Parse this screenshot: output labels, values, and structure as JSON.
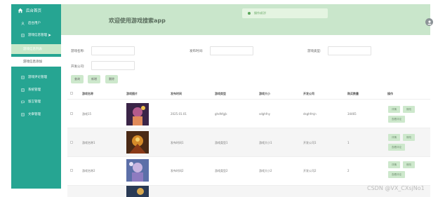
{
  "sidebar": {
    "home_label": "后台首页",
    "items": [
      {
        "label": "后台用户",
        "icon": "user-icon"
      },
      {
        "label": "游戏信息管理",
        "icon": "document-icon"
      },
      {
        "label": "游戏评论管理",
        "icon": "document-icon"
      },
      {
        "label": "系统管理",
        "icon": "document-icon"
      },
      {
        "label": "留言管理",
        "icon": "chat-icon"
      },
      {
        "label": "文章管理",
        "icon": "document-icon"
      }
    ],
    "subitems": [
      {
        "label": "游戏信息列表",
        "active": true
      },
      {
        "label": "游戏信息添加",
        "active": false
      }
    ]
  },
  "header": {
    "title": "欢迎使用游戏搜索app",
    "toast": "操作成功!",
    "user": "admin"
  },
  "search": {
    "fields": [
      {
        "label": "游戏名称:",
        "value": ""
      },
      {
        "label": "发布时间:",
        "value": ""
      },
      {
        "label": "游戏类型:",
        "value": ""
      },
      {
        "label": "开发公司:",
        "value": ""
      }
    ],
    "buttons": [
      "查询",
      "新增",
      "删除"
    ]
  },
  "table": {
    "headers": [
      "游戏名称",
      "游戏图片",
      "发布时间",
      "游戏类型",
      "游戏大小",
      "开发公司",
      "购买数量",
      "操作"
    ],
    "rows": [
      {
        "name": "游戏15",
        "date": "2025.01.01",
        "type": "ghdhfgjk",
        "size": "sdghfny",
        "company": "dsghfmjn",
        "count": "34465"
      },
      {
        "name": "游戏名称1",
        "date": "发布时间1",
        "type": "游戏类型1",
        "size": "游戏大小1",
        "company": "开发公司1",
        "count": "1"
      },
      {
        "name": "游戏名称2",
        "date": "发布时间2",
        "type": "游戏类型2",
        "size": "游戏大小2",
        "company": "开发公司2",
        "count": "2"
      }
    ],
    "row_actions": [
      "详情",
      "修改",
      "查看评论"
    ]
  },
  "watermark": "CSDN @VX_CXsjNo1",
  "colors": {
    "sidebar": "#26a592",
    "header": "#c9e6cb",
    "button": "#cde8cc",
    "active_subitem": "#c8e8c9"
  }
}
